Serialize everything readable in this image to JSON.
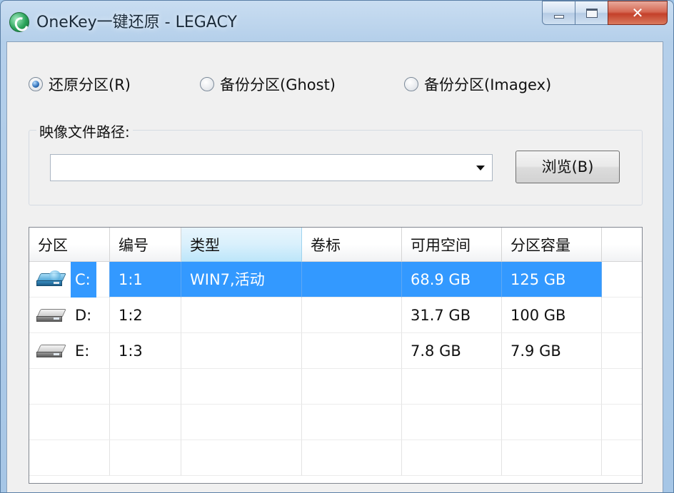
{
  "window": {
    "title": "OneKey一键还原 - LEGACY",
    "controls": {
      "minimize": "",
      "maximize": "",
      "close": "✕"
    }
  },
  "mode": {
    "options": [
      {
        "label": "还原分区(R)",
        "selected": true
      },
      {
        "label": "备份分区(Ghost)",
        "selected": false
      },
      {
        "label": "备份分区(Imagex)",
        "selected": false
      }
    ]
  },
  "image_path": {
    "group_label": "映像文件路径:",
    "value": "",
    "browse_label": "浏览(B)"
  },
  "partitions": {
    "columns": [
      "分区",
      "编号",
      "类型",
      "卷标",
      "可用空间",
      "分区容量"
    ],
    "rows": [
      {
        "drive": "C:",
        "number": "1:1",
        "type": "WIN7,活动",
        "label": "",
        "free": "68.9 GB",
        "capacity": "125 GB",
        "selected": true,
        "icon": "system-drive-icon"
      },
      {
        "drive": "D:",
        "number": "1:2",
        "type": "",
        "label": "",
        "free": "31.7 GB",
        "capacity": "100 GB",
        "selected": false,
        "icon": "hard-drive-icon"
      },
      {
        "drive": "E:",
        "number": "1:3",
        "type": "",
        "label": "",
        "free": "7.8 GB",
        "capacity": "7.9 GB",
        "selected": false,
        "icon": "hard-drive-icon"
      }
    ]
  },
  "colors": {
    "selection": "#3399ff",
    "close_button": "#c4402a",
    "window_frame": "#b4cfea"
  }
}
